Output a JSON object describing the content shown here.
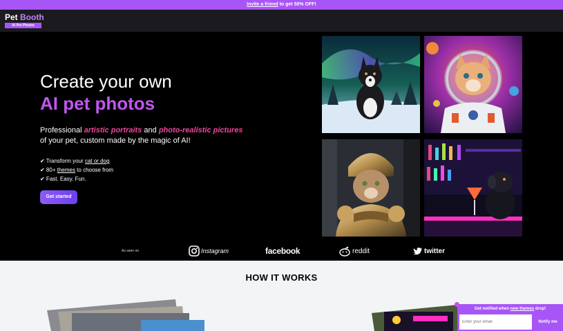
{
  "promo": {
    "link": "Invite a friend",
    "rest": " to get 50% OFF!"
  },
  "nav": {
    "logo_word1": "Pet",
    "logo_word2": "Booth",
    "logo_badge": "AI Pet Photos"
  },
  "hero": {
    "title_line1": "Create your own",
    "title_line2": "AI pet photos",
    "lead": {
      "p1": "Professional ",
      "hl1": "artistic portraits",
      "p2": " and ",
      "hl2": "photo-realistic pictures",
      "p3": " of your pet, custom made by the magic of AI!"
    },
    "bullets": [
      {
        "check": "✔",
        "pre": " Transform your ",
        "link": "cat or dog",
        "post": ""
      },
      {
        "check": "✔",
        "pre": " 80+ ",
        "link": "themes",
        "post": " to choose from"
      },
      {
        "check": "✔",
        "pre": " Fast. Easy. Fun.",
        "link": "",
        "post": ""
      }
    ],
    "cta": "Get started"
  },
  "gallery": [
    {
      "icon": "aurora-dog-image"
    },
    {
      "icon": "astronaut-cat-image"
    },
    {
      "icon": "knight-cat-image"
    },
    {
      "icon": "bar-dog-image"
    }
  ],
  "seen_on": {
    "label": "As seen on",
    "brands": [
      {
        "name": "Instagram",
        "icon": "instagram-icon"
      },
      {
        "name": "facebook",
        "icon": "facebook-logo"
      },
      {
        "name": "reddit",
        "icon": "reddit-icon"
      },
      {
        "name": "twitter",
        "icon": "twitter-icon"
      }
    ]
  },
  "how": {
    "title": "HOW IT WORKS"
  },
  "notify": {
    "title_pre": "Get notified when ",
    "title_link": "new themes",
    "title_post": " drop!",
    "placeholder": "Enter your email",
    "button": "Notify me"
  },
  "colors": {
    "accent": "#a855f7",
    "pink": "#ec4899",
    "purple_text": "#c056f0"
  }
}
